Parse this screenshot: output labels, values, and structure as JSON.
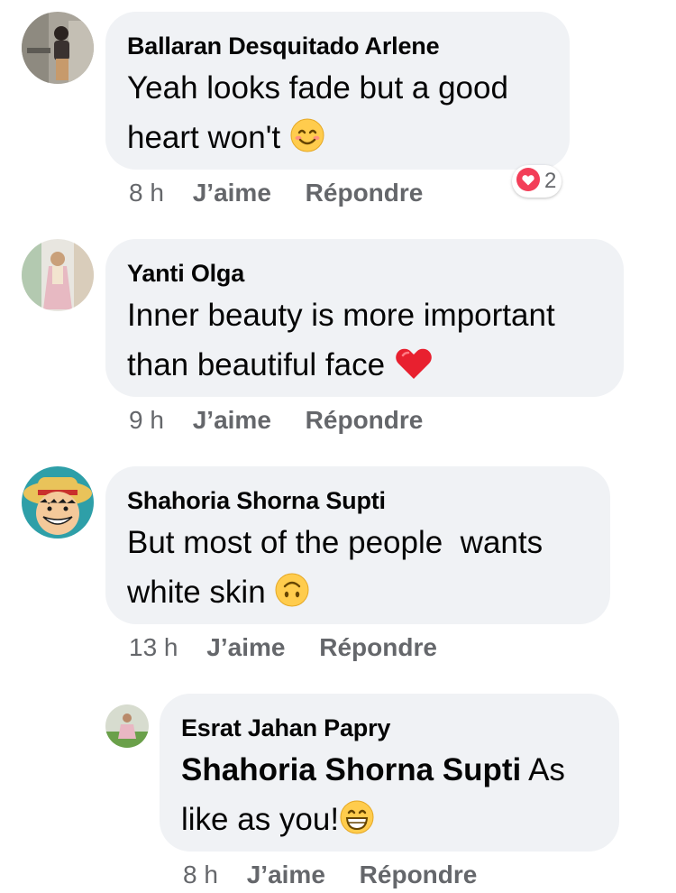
{
  "comments": [
    {
      "author": "Ballaran Desquitado Arlene",
      "line1": "Yeah looks fade but a good",
      "line2": "heart won't",
      "line2_emoji": "smiling-face-icon",
      "time": "8 h",
      "like": "J’aime",
      "reply": "Répondre",
      "reaction": {
        "icon": "love-reaction-icon",
        "count": "2",
        "color": "#f33e58"
      }
    },
    {
      "author": "Yanti Olga",
      "line1": "Inner beauty is more important",
      "line2": "than beautiful face",
      "line2_emoji": "red-heart-icon",
      "time": "9 h",
      "like": "J’aime",
      "reply": "Répondre"
    },
    {
      "author": "Shahoria Shorna Supti",
      "line1": "But most of the people  wants",
      "line2": "white skin",
      "line2_emoji": "upside-down-face-icon",
      "time": "13 h",
      "like": "J’aime",
      "reply": "Répondre"
    },
    {
      "author": "Esrat Jahan Papry",
      "mention": "Shahoria Shorna Supti",
      "line1_rest": "As",
      "line2": "like as you!",
      "line2_emoji": "grinning-face-icon",
      "time": "8 h",
      "like": "J’aime",
      "reply": "Répondre"
    }
  ],
  "colors": {
    "bubble": "#f0f2f5",
    "meta_text": "#65676b",
    "text": "#050505"
  }
}
